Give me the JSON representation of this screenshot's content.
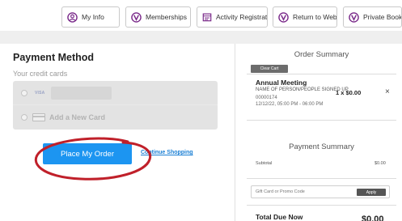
{
  "nav": {
    "buttons": [
      {
        "label": "My Info",
        "icon": "person-circle-icon"
      },
      {
        "label": "Memberships",
        "icon": "membership-logo-icon",
        "caret": "▾"
      },
      {
        "label": "Activity Registration",
        "icon": "calendar-icon"
      },
      {
        "label": "Return to Website",
        "icon": "membership-logo-icon"
      },
      {
        "label": "Private Booking",
        "icon": "membership-logo-icon"
      }
    ],
    "icon_color": "#7a2a8a"
  },
  "payment": {
    "title": "Payment Method",
    "cards_label": "Your credit cards",
    "saved_card": {
      "brand": "VISA"
    },
    "add_card_label": "Add a New Card",
    "place_order_label": "Place My Order",
    "continue_label": "Continue Shopping",
    "accent_color": "#1c95f1",
    "annotation_color": "#c0202a"
  },
  "order_summary": {
    "title": "Order Summary",
    "clear_cart_label": "Clear Cart",
    "item": {
      "title": "Annual Meeting",
      "person": "NAME OF PERSON/PEOPLE SIGNED UP",
      "id": "00000174",
      "datetime": "12/12/22, 05:00 PM - 06:00 PM",
      "qty_price": "1 x $0.00",
      "remove_icon": "×"
    }
  },
  "payment_summary": {
    "title": "Payment Summary",
    "subtotal_label": "Subtotal",
    "subtotal_value": "$0.00",
    "promo_placeholder": "Gift Card or Promo Code",
    "apply_label": "Apply",
    "total_label": "Total Due Now",
    "total_value": "$0.00"
  }
}
